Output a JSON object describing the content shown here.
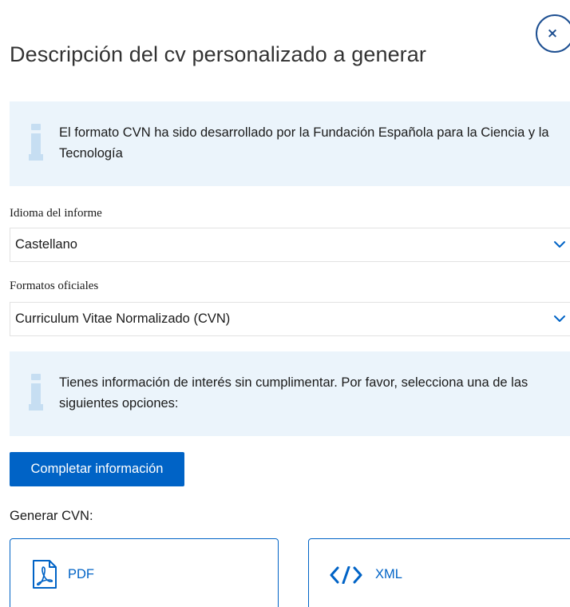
{
  "modal": {
    "title": "Descripción del cv personalizado a generar",
    "close_label": "×"
  },
  "info_boxes": [
    {
      "text": "El formato CVN ha sido desarrollado por la Fundación Española para la Ciencia y la Tecnología",
      "icon": "info-icon"
    },
    {
      "text": "Tienes información de interés sin cumplimentar. Por favor, selecciona una de las siguientes opciones:",
      "icon": "info-icon"
    }
  ],
  "fields": {
    "language": {
      "label": "Idioma del informe",
      "value": "Castellano"
    },
    "format": {
      "label": "Formatos oficiales",
      "value": "Curriculum Vitae Normalizado (CVN)"
    }
  },
  "actions": {
    "complete_info_label": "Completar información"
  },
  "generate": {
    "label": "Generar CVN:",
    "options": [
      {
        "label": "PDF",
        "icon": "pdf-file-icon"
      },
      {
        "label": "XML",
        "icon": "code-icon"
      }
    ]
  },
  "colors": {
    "primary": "#0063c6",
    "close_border": "#1d4f91",
    "info_background": "#ebf4fb",
    "info_icon": "#c6def2"
  }
}
